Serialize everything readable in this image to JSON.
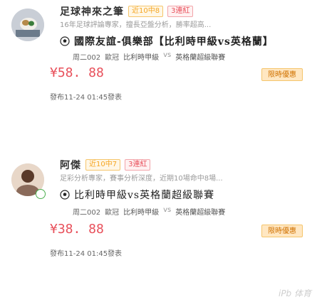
{
  "posts": [
    {
      "author_name": "足球神來之筆",
      "tag_streak": "近10中8",
      "tag_hot": "3連紅",
      "meta": "16年足球評論專家，擅長亞盤分析，勝率超高...",
      "match_title": "國際友誼-俱樂部【比利時甲級vs英格蘭】",
      "detail": {
        "match_id": "周二002",
        "league": "歐冠",
        "home_team": "比利時甲級",
        "vs": "vs",
        "away_team": "英格蘭超級聯賽"
      },
      "price": "¥58. 88",
      "promo_label": "限時優惠",
      "time": "發布11-24 01:45發表"
    },
    {
      "author_name": "阿傑",
      "tag_streak": "近10中7",
      "tag_hot": "3連紅",
      "meta": "足彩分析專家，賽事分析深度，近期10場命中8場...",
      "match_title": "比利時甲級vs英格蘭超級聯賽",
      "detail": {
        "match_id": "周二002",
        "league": "歐冠",
        "home_team": "比利時甲級",
        "vs": "vs",
        "away_team": "英格蘭超級聯賽"
      },
      "price": "¥38. 88",
      "promo_label": "限時優惠",
      "time": "發布11-24 01:45發表"
    }
  ],
  "watermark": "iPb 体育",
  "colors": {
    "price": "#e8505b",
    "promo_bg": "#ffe7c2",
    "promo_text": "#d07200",
    "tag_streak": "#f5a623",
    "tag_hot": "#e8505b"
  }
}
